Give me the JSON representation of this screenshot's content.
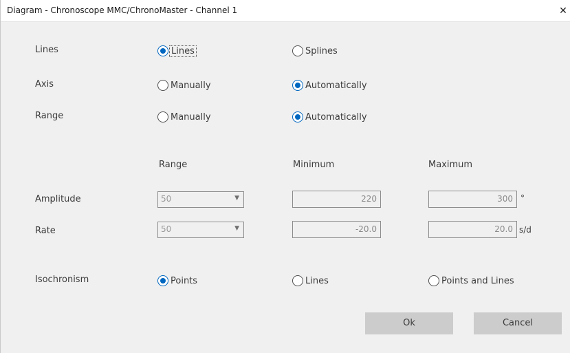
{
  "window": {
    "title": "Diagram - Chronoscope MMC/ChronoMaster - Channel 1",
    "close_glyph": "✕"
  },
  "settings": {
    "lines": {
      "label": "Lines",
      "options": [
        {
          "label": "Lines",
          "checked": true
        },
        {
          "label": "Splines",
          "checked": false
        }
      ]
    },
    "axis": {
      "label": "Axis",
      "options": [
        {
          "label": "Manually",
          "checked": false
        },
        {
          "label": "Automatically",
          "checked": true
        }
      ]
    },
    "range": {
      "label": "Range",
      "options": [
        {
          "label": "Manually",
          "checked": false
        },
        {
          "label": "Automatically",
          "checked": true
        }
      ]
    }
  },
  "table": {
    "headers": {
      "range": "Range",
      "minimum": "Minimum",
      "maximum": "Maximum"
    },
    "rows": [
      {
        "label": "Amplitude",
        "range": "50",
        "minimum": "220",
        "maximum": "300",
        "unit": "°"
      },
      {
        "label": "Rate",
        "range": "50",
        "minimum": "-20.0",
        "maximum": "20.0",
        "unit": "s/d"
      }
    ]
  },
  "isochronism": {
    "label": "Isochronism",
    "options": [
      {
        "label": "Points",
        "checked": true
      },
      {
        "label": "Lines",
        "checked": false
      },
      {
        "label": "Points and Lines",
        "checked": false
      }
    ]
  },
  "buttons": {
    "ok": "Ok",
    "cancel": "Cancel"
  },
  "icons": {
    "dropdown": "chevron-down-icon",
    "close": "close-icon"
  },
  "colors": {
    "radio_accent": "#0067c0",
    "button_bg": "#cccccc",
    "dialog_bg": "#f0f0f0"
  }
}
